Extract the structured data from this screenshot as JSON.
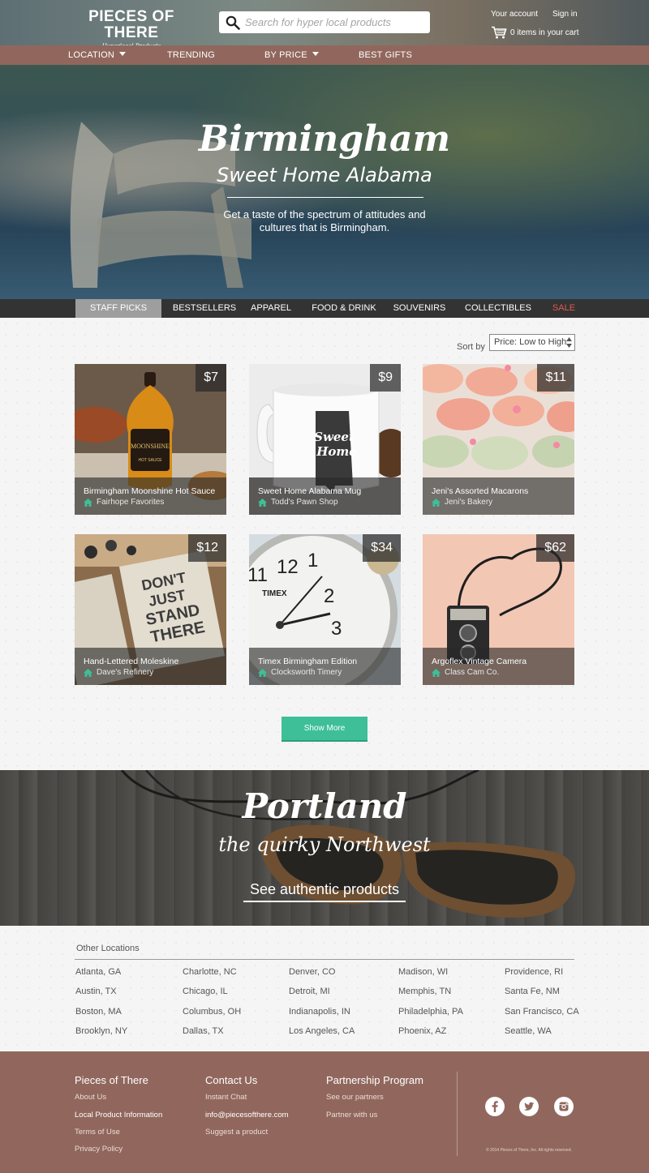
{
  "header": {
    "logo_title": "PIECES OF THERE",
    "logo_tagline": "Hyperlocal Products",
    "search_placeholder": "Search for hyper local products",
    "account_link": "Your account",
    "signin_link": "Sign in",
    "cart_text": "0 items in your cart"
  },
  "nav": {
    "location": "LOCATION",
    "trending": "TRENDING",
    "by_price": "BY PRICE",
    "best_gifts": "BEST GIFTS"
  },
  "hero": {
    "city": "Birmingham",
    "tagline": "Sweet Home Alabama",
    "description": "Get a taste of the spectrum of attitudes and cultures that is Birmingham."
  },
  "categories": {
    "staff_picks": "STAFF PICKS",
    "bestsellers": "BESTSELLERS",
    "apparel": "APPAREL",
    "food_drink": "FOOD & DRINK",
    "souvenirs": "SOUVENIRS",
    "collectibles": "COLLECTIBLES",
    "sale": "SALE"
  },
  "sort": {
    "label": "Sort by",
    "selected": "Price: Low to High"
  },
  "products": [
    {
      "name": "Birmingham Moonshine Hot Sauce",
      "shop": "Fairhope Favorites",
      "price": "$7"
    },
    {
      "name": "Sweet Home Alabama Mug",
      "shop": "Todd's Pawn Shop",
      "price": "$9"
    },
    {
      "name": "Jeni's Assorted Macarons",
      "shop": "Jeni's Bakery",
      "price": "$11"
    },
    {
      "name": "Hand-Lettered Moleskine",
      "shop": "Dave's Refinery",
      "price": "$12"
    },
    {
      "name": "Timex Birmingham Edition",
      "shop": "Clocksworth Timery",
      "price": "$34"
    },
    {
      "name": "Argoflex Vintage Camera",
      "shop": "Class Cam Co.",
      "price": "$62"
    }
  ],
  "product_art": {
    "hot_sauce_label": "MOONSHINE",
    "hot_sauce_sublabel": "HOT SAUCE",
    "mug_text_1": "Sweet",
    "mug_text_2": "Home",
    "notebook_text_1": "DON'T",
    "notebook_text_2": "JUST",
    "notebook_text_3": "STAND",
    "notebook_text_4": "THERE",
    "clock_brand": "TIMEX",
    "clock_12": "12",
    "clock_1": "1",
    "clock_2": "2",
    "clock_3": "3",
    "clock_11": "11"
  },
  "show_more": "Show More",
  "portland": {
    "city": "Portland",
    "tagline": "the quirky Northwest",
    "link": "See authentic products"
  },
  "locations": {
    "heading": "Other Locations",
    "columns": [
      [
        "Atlanta, GA",
        "Austin, TX",
        "Boston, MA",
        "Brooklyn, NY"
      ],
      [
        "Charlotte, NC",
        "Chicago, IL",
        "Columbus, OH",
        "Dallas, TX"
      ],
      [
        "Denver, CO",
        "Detroit, MI",
        "Indianapolis, IN",
        "Los Angeles, CA"
      ],
      [
        "Madison, WI",
        "Memphis, TN",
        "Philadelphia, PA",
        "Phoenix, AZ"
      ],
      [
        "Providence, RI",
        "Santa Fe, NM",
        "San Francisco, CA",
        "Seattle, WA"
      ]
    ]
  },
  "footer": {
    "col1_title": "Pieces of There",
    "col1_links": [
      "About Us",
      "Local Product Information",
      "Terms of Use",
      "Privacy Policy"
    ],
    "col2_title": "Contact Us",
    "col2_links": [
      "Instant Chat",
      "info@piecesofthere.com",
      "Suggest a product"
    ],
    "col3_title": "Partnership Program",
    "col3_links": [
      "See our partners",
      "Partner with us"
    ],
    "copyright": "© 2014 Pieces of There, Inc. All rights reserved."
  },
  "icons": [
    "search-icon",
    "cart-icon",
    "caret-down-icon",
    "home-icon",
    "facebook-icon",
    "twitter-icon",
    "instagram-icon"
  ],
  "colors": {
    "nav_brown": "#91675d",
    "accent_green": "#3ebf98",
    "sale_red": "#e05a4f",
    "category_bar": "#333333"
  }
}
